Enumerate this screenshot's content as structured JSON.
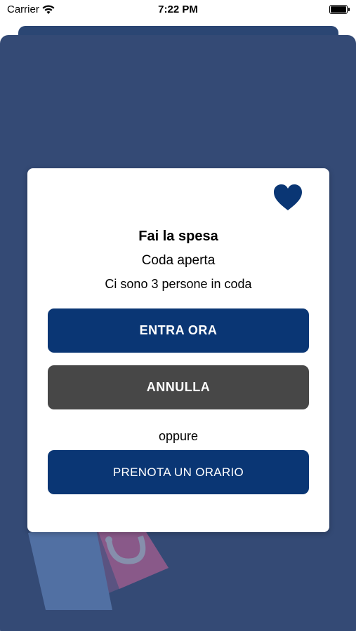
{
  "status_bar": {
    "carrier": "Carrier",
    "time": "7:22 PM",
    "icons": [
      "wifi-icon",
      "battery-icon"
    ]
  },
  "modal": {
    "title": "Fai la spesa",
    "status": "Coda aperta",
    "queue_info": "Ci sono 3 persone in coda",
    "enter_label": "ENTRA ORA",
    "cancel_label": "ANNULLA",
    "or_label": "oppure",
    "book_label": "PRENOTA UN ORARIO",
    "favorite_icon": "heart-icon"
  },
  "colors": {
    "sheet_background": "#344a75",
    "primary_button": "#0a3674",
    "secondary_button": "#474747",
    "heart": "#0a3674"
  }
}
